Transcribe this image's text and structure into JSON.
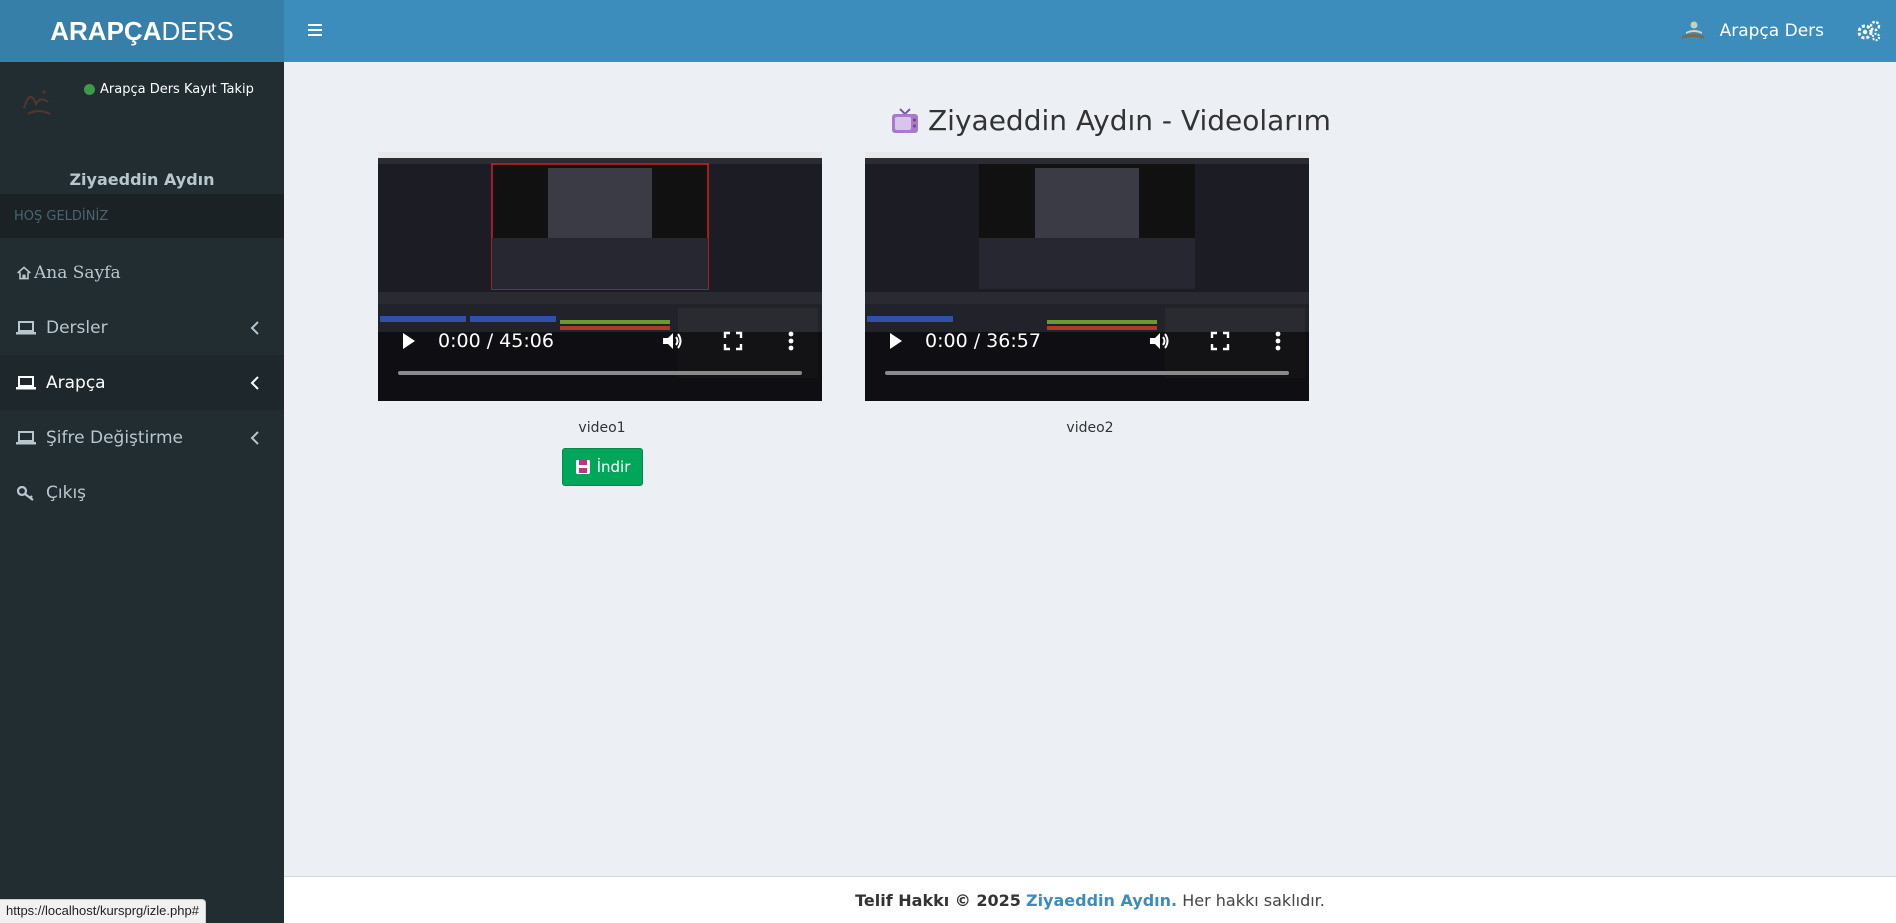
{
  "brand": {
    "bold": "ARAPÇA",
    "light": "DERS"
  },
  "header": {
    "user_label": "Arapça Ders"
  },
  "sidebar": {
    "status_text": "Arapça Ders Kayıt Takip",
    "user_name": "Ziyaeddin Aydın",
    "section_label": "HOŞ GELDİNİZ",
    "items": [
      {
        "label": "Ana Sayfa",
        "icon": "home-icon"
      },
      {
        "label": "Dersler",
        "icon": "laptop-icon"
      },
      {
        "label": "Arapça",
        "icon": "laptop-icon"
      },
      {
        "label": "Şifre Değiştirme",
        "icon": "laptop-icon"
      },
      {
        "label": "Çıkış",
        "icon": "key-icon"
      }
    ]
  },
  "main": {
    "title": "Ziyaeddin Aydın - Videolarım",
    "videos": [
      {
        "time": "0:00 / 45:06",
        "caption": "video1",
        "progress": 0
      },
      {
        "time": "0:00 / 36:57",
        "caption": "video2",
        "progress": 0
      }
    ],
    "download_label": "İndir"
  },
  "footer": {
    "prefix": "Telif Hakkı © 2025",
    "author": "Ziyaeddin Aydın.",
    "suffix": "Her hakkı saklıdır."
  },
  "statusbar": {
    "url": "https://localhost/kursprg/izle.php#"
  },
  "colors": {
    "header": "#3c8dbc",
    "logo": "#367fa9",
    "sidebar": "#222d32",
    "success": "#00a65a"
  }
}
